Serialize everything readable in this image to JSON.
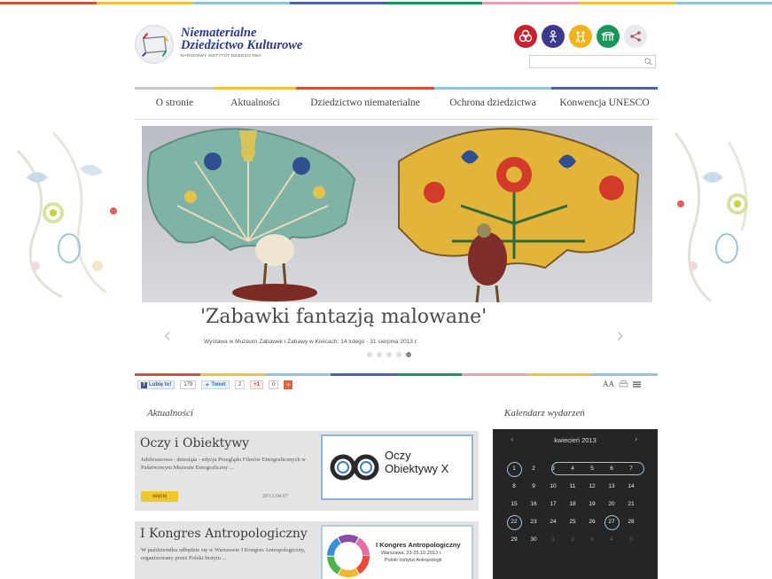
{
  "site": {
    "title_line1": "Niematerialne",
    "title_line2": "Dziedzictwo Kulturowe",
    "subtitle": "NARODOWY INSTYTUT DZIEDZICTWA"
  },
  "search": {
    "placeholder": "",
    "value": ""
  },
  "domain_icons": [
    {
      "icon": "knot-icon",
      "color": "#c8232f"
    },
    {
      "icon": "figure-icon",
      "color": "#3d3a8e"
    },
    {
      "icon": "dancers-icon",
      "color": "#f1b21c"
    },
    {
      "icon": "bridge-icon",
      "color": "#19975a"
    },
    {
      "icon": "share-icon",
      "color": "#e8eaee"
    }
  ],
  "nav": {
    "items": [
      {
        "label": "O stronie",
        "color": "#c7c7c7"
      },
      {
        "label": "Aktualności",
        "color": "#f0c13a"
      },
      {
        "label": "Dziedzictwo niematerialne",
        "color": "#d0503a"
      },
      {
        "label": "Ochrona dziedzictwa",
        "color": "#8fc6d9"
      },
      {
        "label": "Konwencja UNESCO",
        "color": "#4b63a8"
      }
    ]
  },
  "slider": {
    "title": "'Zabawki fantazją malowane'",
    "description": "Wystawa w Muzeum Zabawek i Zabawy w Kielcach: 14 lutego - 31 sierpnia 2013 r.",
    "prev_arrow": "‹",
    "next_arrow": "›",
    "dots": 5,
    "active_dot": 4
  },
  "social": {
    "fb_label": "Lubię to!",
    "fb_count": "179",
    "tweet_label": "Tweet",
    "tweet_count": "2",
    "gplus_label": "+1",
    "gplus_count": "0",
    "font_size_label": "AA"
  },
  "news": {
    "heading": "Aktualności",
    "items": [
      {
        "title": "Oczy i Obiektywy",
        "text": "Jubileuszowa - dziesiąta - edycja Przeglądu Filmów Etnograficznych w Państwowym Muzeum Etnograficzny ...",
        "date": "2013.04.07",
        "more": "więcej",
        "thumb_text1": "Oczy",
        "thumb_text2": "Obiektywy X"
      },
      {
        "title": "I Kongres Antropologiczny",
        "text": "W październiku odbędzie się w Warszawie I Kongres Antropologiczny, organizowany przez Polski Instytu ...",
        "thumb_text1": "I Kongres Antropologiczny",
        "thumb_text2": "Warszawa, 23-25.10.2013 r.",
        "thumb_text3": "Polski Instytut Antropologii"
      }
    ]
  },
  "calendar": {
    "heading": "Kalendarz wydarzeń",
    "month": "kwiecień 2013",
    "prev": "‹",
    "next": "›",
    "days": [
      {
        "d": "1",
        "ev": true
      },
      {
        "d": "2"
      },
      {
        "d": "3"
      },
      {
        "d": "4"
      },
      {
        "d": "5",
        "pill": true
      },
      {
        "d": "6",
        "pill": true
      },
      {
        "d": "7",
        "pill": true
      },
      {
        "d": "8"
      },
      {
        "d": "9"
      },
      {
        "d": "10"
      },
      {
        "d": "11"
      },
      {
        "d": "12"
      },
      {
        "d": "13"
      },
      {
        "d": "14"
      },
      {
        "d": "15"
      },
      {
        "d": "16"
      },
      {
        "d": "17"
      },
      {
        "d": "18"
      },
      {
        "d": "19"
      },
      {
        "d": "20"
      },
      {
        "d": "21"
      },
      {
        "d": "22",
        "ev": true
      },
      {
        "d": "23"
      },
      {
        "d": "24"
      },
      {
        "d": "25"
      },
      {
        "d": "26"
      },
      {
        "d": "27",
        "ev": true
      },
      {
        "d": "28"
      },
      {
        "d": "29"
      },
      {
        "d": "30"
      },
      {
        "d": "1",
        "muted": true
      },
      {
        "d": "2",
        "muted": true
      },
      {
        "d": "3",
        "muted": true
      },
      {
        "d": "4",
        "muted": true
      },
      {
        "d": "5",
        "muted": true
      }
    ]
  },
  "colors": {
    "stripe": [
      "#d0503a",
      "#f0c13a",
      "#8fc6d9",
      "#4b63a8",
      "#19975a",
      "#e8a2b0",
      "#f0c13a",
      "#8fc6d9"
    ]
  }
}
